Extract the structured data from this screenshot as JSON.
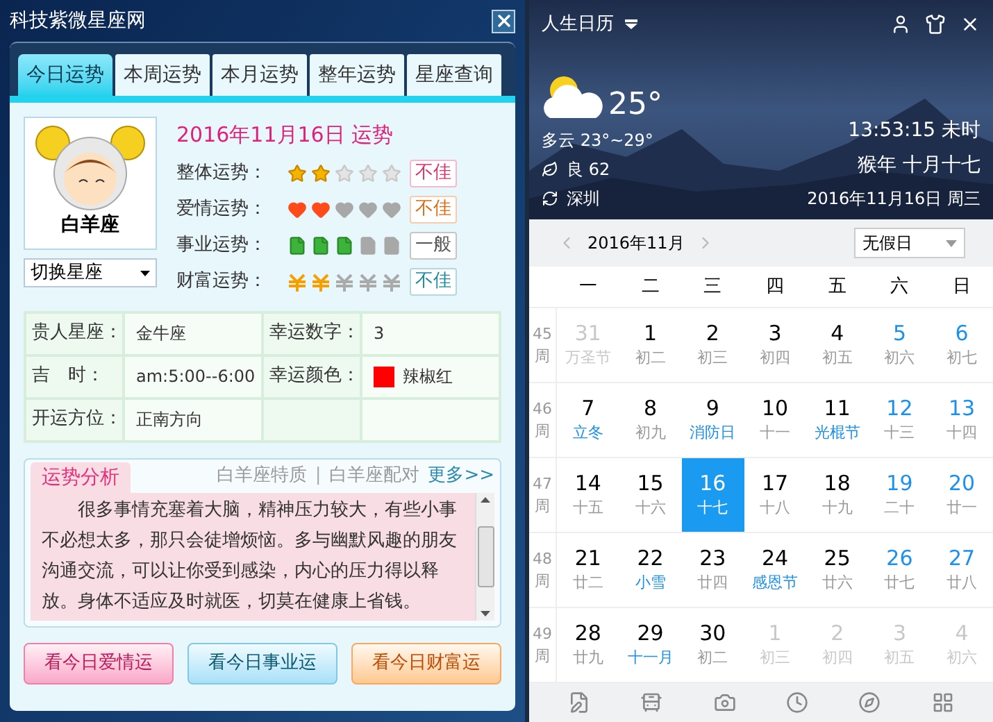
{
  "left": {
    "title": "科技紫微星座网",
    "tabs": [
      {
        "label": "今日运势",
        "selected": true
      },
      {
        "label": "本周运势",
        "selected": false
      },
      {
        "label": "本月运势",
        "selected": false
      },
      {
        "label": "整年运势",
        "selected": false
      },
      {
        "label": "星座查询",
        "selected": false
      }
    ],
    "sign": {
      "name": "白羊座",
      "switch": "切换星座"
    },
    "date_heading": "2016年11月16日 运势",
    "ratings": [
      {
        "kind": "star",
        "label": "整体运势：",
        "stars": 2,
        "verdict": "不佳",
        "color": "#e0306a"
      },
      {
        "kind": "heart",
        "label": "爱情运势：",
        "stars": 2,
        "verdict": "不佳",
        "color": "#e06a10"
      },
      {
        "kind": "career",
        "label": "事业运势：",
        "stars": 3,
        "verdict": "一般",
        "color": "#555555"
      },
      {
        "kind": "wealth",
        "label": "财富运势：",
        "stars": 2,
        "verdict": "不佳",
        "color": "#1a8aa0"
      }
    ],
    "info": [
      {
        "cells": [
          {
            "label": "贵人星座：",
            "value": "金牛座"
          },
          {
            "label": "幸运数字：",
            "value": "3"
          }
        ]
      },
      {
        "cells": [
          {
            "label": "吉　时：",
            "value": "am:5:00--6:00"
          },
          {
            "label": "幸运颜色：",
            "value": "辣椒红",
            "color": "#ff0000"
          }
        ]
      },
      {
        "cells": [
          {
            "label": "开运方位：",
            "value": "正南方向"
          }
        ]
      }
    ],
    "analysis": {
      "tab": "运势分析",
      "links": [
        "白羊座特质",
        "白羊座配对"
      ],
      "separator": "|",
      "more": "更多>>",
      "text": "很多事情充塞着大脑，精神压力较大，有些小事不必想太多，那只会徒增烦恼。多与幽默风趣的朋友沟通交流，可以让你受到感染，内心的压力得以释放。身体不适应及时就医，切莫在健康上省钱。"
    },
    "buttons": [
      {
        "kind": "love",
        "label": "看今日爱情运"
      },
      {
        "kind": "career",
        "label": "看今日事业运"
      },
      {
        "kind": "wealth",
        "label": "看今日财富运"
      }
    ]
  },
  "right": {
    "app_title": "人生日历",
    "weather": {
      "temperature": "25°",
      "condition": "多云 23°~29°",
      "air": "良 62",
      "city": "深圳"
    },
    "time": "13:53:15 未时",
    "lunar_date": "猴年 十月十七",
    "date": "2016年11月16日 周三",
    "month": "2016年11月",
    "holiday_select": "无假日",
    "weekdays": [
      "一",
      "二",
      "三",
      "四",
      "五",
      "六",
      "日"
    ],
    "weeks": [
      {
        "number": "45",
        "unit": "周",
        "days": [
          {
            "day": "31",
            "lunar": "万圣节",
            "muted": true,
            "selected": false
          },
          {
            "day": "1",
            "lunar": "初二",
            "muted": false,
            "festival": false,
            "selected": false
          },
          {
            "day": "2",
            "lunar": "初三",
            "muted": false,
            "festival": false,
            "selected": false
          },
          {
            "day": "3",
            "lunar": "初四",
            "muted": false,
            "festival": false,
            "selected": false
          },
          {
            "day": "4",
            "lunar": "初五",
            "muted": false,
            "festival": false,
            "selected": false
          },
          {
            "day": "5",
            "lunar": "初六",
            "muted": false,
            "festival": false,
            "selected": false
          },
          {
            "day": "6",
            "lunar": "初七",
            "muted": false,
            "festival": false,
            "selected": false
          }
        ]
      },
      {
        "number": "46",
        "unit": "周",
        "days": [
          {
            "day": "7",
            "lunar": "立冬",
            "muted": false,
            "festival": true,
            "selected": false
          },
          {
            "day": "8",
            "lunar": "初九",
            "muted": false,
            "festival": false,
            "selected": false
          },
          {
            "day": "9",
            "lunar": "消防日",
            "muted": false,
            "festival": true,
            "selected": false
          },
          {
            "day": "10",
            "lunar": "十一",
            "muted": false,
            "festival": false,
            "selected": false
          },
          {
            "day": "11",
            "lunar": "光棍节",
            "muted": false,
            "festival": true,
            "selected": false
          },
          {
            "day": "12",
            "lunar": "十三",
            "muted": false,
            "festival": false,
            "selected": false
          },
          {
            "day": "13",
            "lunar": "十四",
            "muted": false,
            "festival": false,
            "selected": false
          }
        ]
      },
      {
        "number": "47",
        "unit": "周",
        "days": [
          {
            "day": "14",
            "lunar": "十五",
            "muted": false,
            "festival": false,
            "selected": false
          },
          {
            "day": "15",
            "lunar": "十六",
            "muted": false,
            "festival": false,
            "selected": false
          },
          {
            "day": "16",
            "lunar": "十七",
            "selected": true
          },
          {
            "day": "17",
            "lunar": "十八",
            "muted": false,
            "festival": false,
            "selected": false
          },
          {
            "day": "18",
            "lunar": "十九",
            "muted": false,
            "festival": false,
            "selected": false
          },
          {
            "day": "19",
            "lunar": "二十",
            "muted": false,
            "festival": false,
            "selected": false
          },
          {
            "day": "20",
            "lunar": "廿一",
            "muted": false,
            "festival": false,
            "selected": false
          }
        ]
      },
      {
        "number": "48",
        "unit": "周",
        "days": [
          {
            "day": "21",
            "lunar": "廿二",
            "muted": false,
            "festival": false,
            "selected": false
          },
          {
            "day": "22",
            "lunar": "小雪",
            "muted": false,
            "festival": true,
            "selected": false
          },
          {
            "day": "23",
            "lunar": "廿四",
            "muted": false,
            "festival": false,
            "selected": false
          },
          {
            "day": "24",
            "lunar": "感恩节",
            "muted": false,
            "festival": true,
            "selected": false
          },
          {
            "day": "25",
            "lunar": "廿六",
            "muted": false,
            "festival": false,
            "selected": false
          },
          {
            "day": "26",
            "lunar": "廿七",
            "muted": false,
            "festival": false,
            "selected": false
          },
          {
            "day": "27",
            "lunar": "廿八",
            "muted": false,
            "festival": false,
            "selected": false
          }
        ]
      },
      {
        "number": "49",
        "unit": "周",
        "days": [
          {
            "day": "28",
            "lunar": "廿九",
            "muted": false,
            "festival": false,
            "selected": false
          },
          {
            "day": "29",
            "lunar": "十一月",
            "muted": false,
            "festival": true,
            "selected": false
          },
          {
            "day": "30",
            "lunar": "初二",
            "muted": false,
            "festival": false,
            "selected": false
          },
          {
            "day": "1",
            "lunar": "初三",
            "muted": true,
            "selected": false
          },
          {
            "day": "2",
            "lunar": "初四",
            "muted": true,
            "selected": false
          },
          {
            "day": "3",
            "lunar": "初五",
            "muted": true,
            "selected": false
          },
          {
            "day": "4",
            "lunar": "初六",
            "muted": true,
            "selected": false
          }
        ]
      }
    ]
  }
}
